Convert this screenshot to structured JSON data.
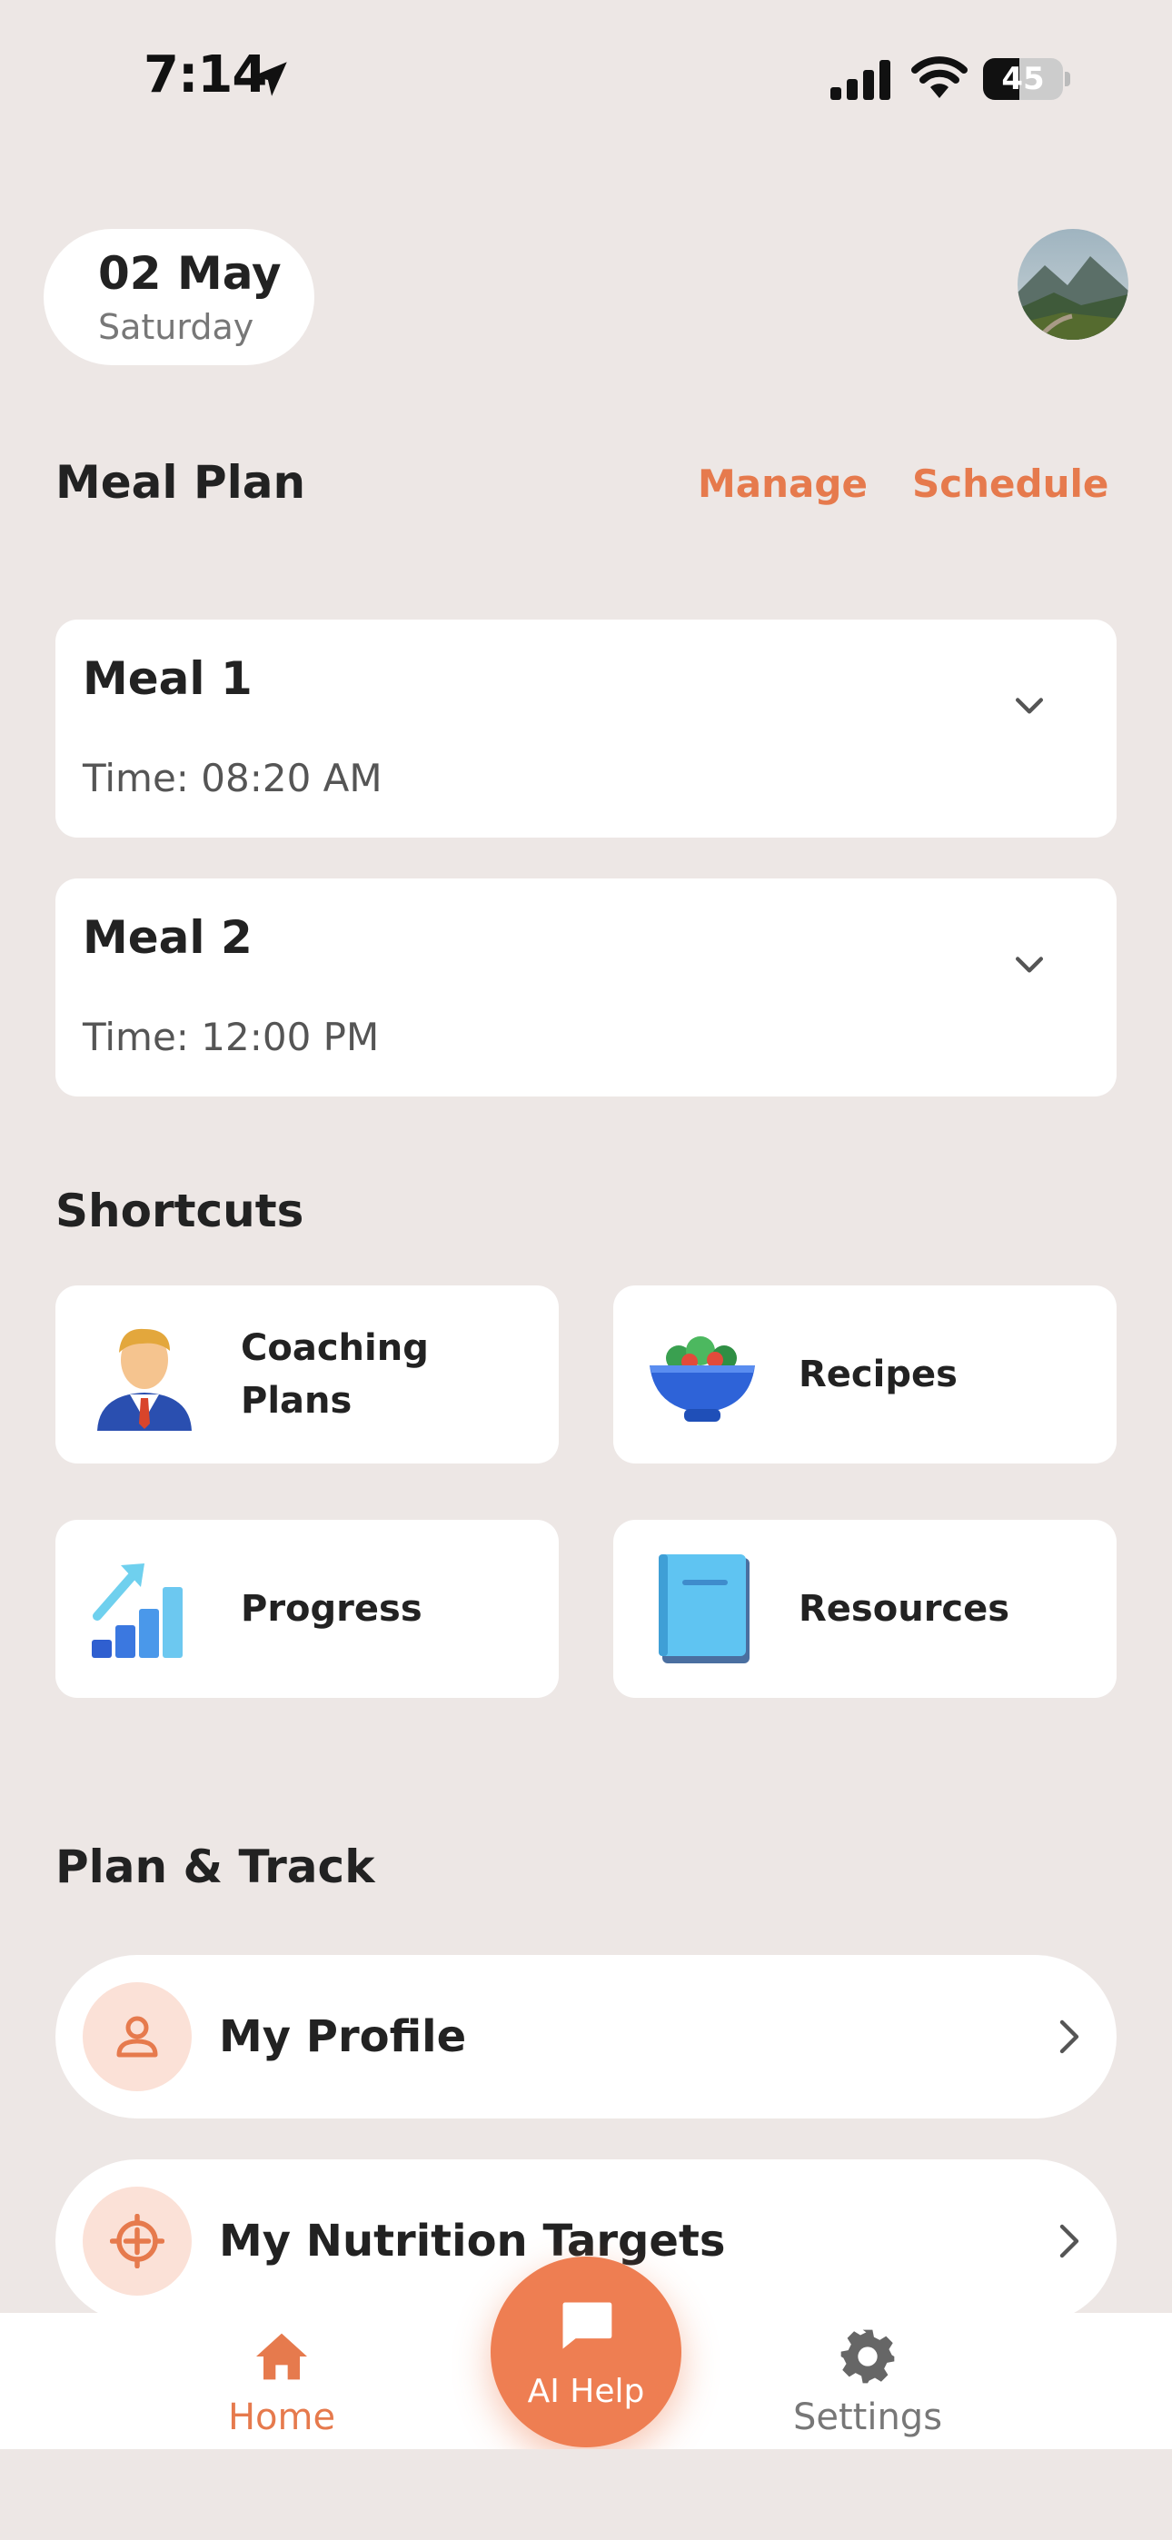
{
  "status_bar": {
    "time": "7:14",
    "battery_level": "45",
    "battery_fraction": 0.45,
    "icons": [
      "location-arrow-icon",
      "cellular-signal-icon",
      "wifi-icon",
      "battery-icon"
    ]
  },
  "header": {
    "date": "02 May",
    "weekday": "Saturday",
    "avatar_icon": "profile-photo"
  },
  "meal_plan": {
    "title": "Meal Plan",
    "manage_label": "Manage",
    "schedule_label": "Schedule",
    "meals": [
      {
        "title": "Meal 1",
        "time": "Time: 08:20 AM"
      },
      {
        "title": "Meal 2",
        "time": "Time: 12:00 PM"
      }
    ]
  },
  "shortcuts": {
    "title": "Shortcuts",
    "items": [
      {
        "label": "Coaching Plans",
        "icon": "coach-icon"
      },
      {
        "label": "Recipes",
        "icon": "salad-bowl-icon"
      },
      {
        "label": "Progress",
        "icon": "bar-chart-icon"
      },
      {
        "label": "Resources",
        "icon": "book-icon"
      }
    ]
  },
  "plan_track": {
    "title": "Plan & Track",
    "items": [
      {
        "label": "My Profile",
        "icon": "person-icon"
      },
      {
        "label": "My Nutrition Targets",
        "icon": "target-icon"
      }
    ]
  },
  "bottom_nav": {
    "home_label": "Home",
    "ai_label": "AI Help",
    "settings_label": "Settings"
  },
  "colors": {
    "background": "#EDE7E5",
    "accent": "#EE7E52",
    "accent_text": "#E67A4D",
    "icon_circle": "#FBE1D7"
  }
}
